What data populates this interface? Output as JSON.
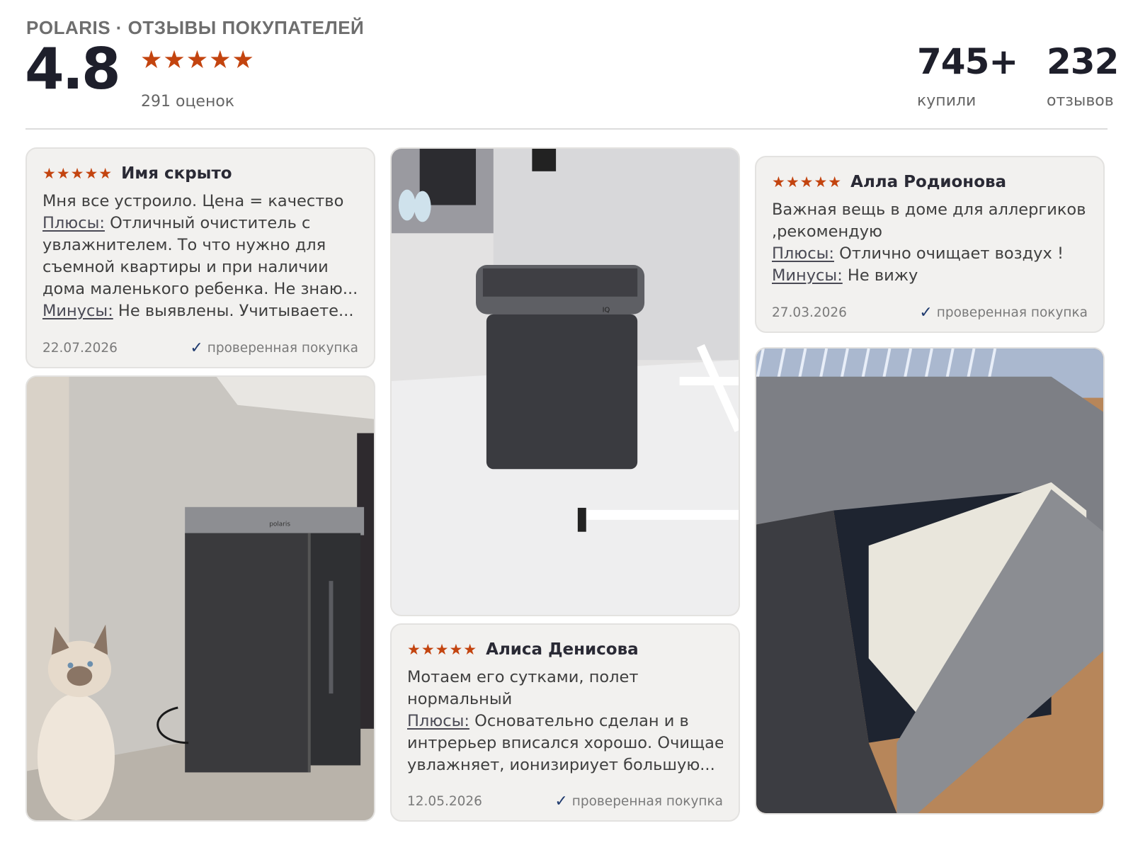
{
  "header": {
    "brand": "POLARIS · ОТЗЫВЫ ПОКУПАТЕЛЕЙ",
    "rating": "4.8",
    "stars": "★★★★★",
    "ratings_count": "291 оценок",
    "bought_value": "745+",
    "bought_label": "купили",
    "reviews_value": "232",
    "reviews_label": "отзывов"
  },
  "colors": {
    "star": "#c3440f",
    "title": "#1e1f2b",
    "card_bg": "#f2f1ef",
    "check": "#1f3a6e"
  },
  "icons": {
    "star": "star-icon",
    "verified": "checkmark-icon"
  },
  "reviews": [
    {
      "stars": "★★★★★",
      "author": "Имя скрыто",
      "line1": "Мня все устроило. Цена = качество",
      "pros_label": "Плюсы:",
      "pros_line1": " Отличный очиститель с",
      "line3": "увлажнителем. То что нужно для",
      "line4": "съемной квартиры и при наличии",
      "line5": "дома маленького ребенка. Не знаю...",
      "cons_label": "Минусы:",
      "cons_text": " Не выявлены. Учитываете...",
      "date": "22.07.2026",
      "verified": "проверенная покупка"
    },
    {
      "stars": "★★★★★",
      "author": "Алиса Денисова",
      "line1": "Мотаем его сутками, полет",
      "line2": "нормальный",
      "pros_label": "Плюсы:",
      "pros_line1": " Основательно сделан и в",
      "line4": "интрерьер вписался хорошо. Очищает,",
      "line5": "увлажняет, ионизириует большую...",
      "date": "12.05.2026",
      "verified": "проверенная покупка"
    },
    {
      "stars": "★★★★★",
      "author": "Алла Родионова",
      "line1": "Важная вещь в доме для аллергиков",
      "line2": ",рекомендую",
      "pros_label": "Плюсы:",
      "pros_text": " Отлично очищает воздух !",
      "cons_label": "Минусы:",
      "cons_text": " Не вижу",
      "date": "27.03.2026",
      "verified": "проверенная покупка"
    }
  ],
  "photos": {
    "purifier_brand": "polaris",
    "purifier_badge": "IQ"
  }
}
